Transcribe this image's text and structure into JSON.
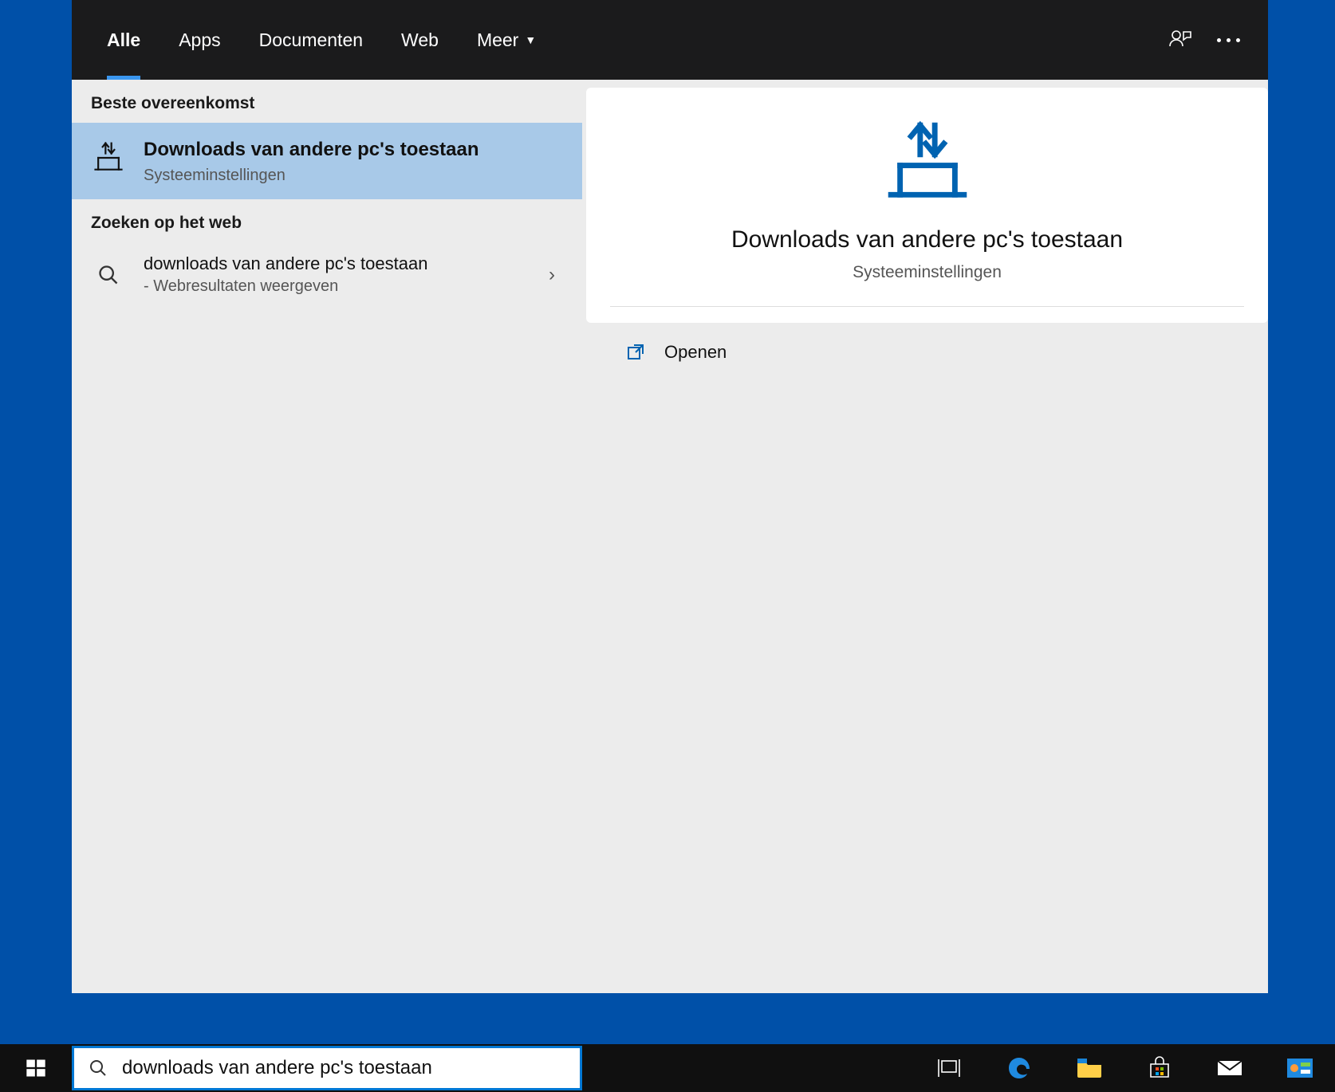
{
  "tabs": {
    "all": "Alle",
    "apps": "Apps",
    "docs": "Documenten",
    "web": "Web",
    "more": "Meer"
  },
  "groups": {
    "best_match": "Beste overeenkomst",
    "web_search": "Zoeken op het web"
  },
  "best_result": {
    "title": "Downloads van andere pc's toestaan",
    "subtitle": "Systeeminstellingen"
  },
  "web_result": {
    "title": "downloads van andere pc's toestaan",
    "subtitle": "- Webresultaten weergeven"
  },
  "detail": {
    "title": "Downloads van andere pc's toestaan",
    "subtitle": "Systeeminstellingen",
    "open_label": "Openen"
  },
  "search": {
    "value": "downloads van andere pc's toestaan"
  }
}
